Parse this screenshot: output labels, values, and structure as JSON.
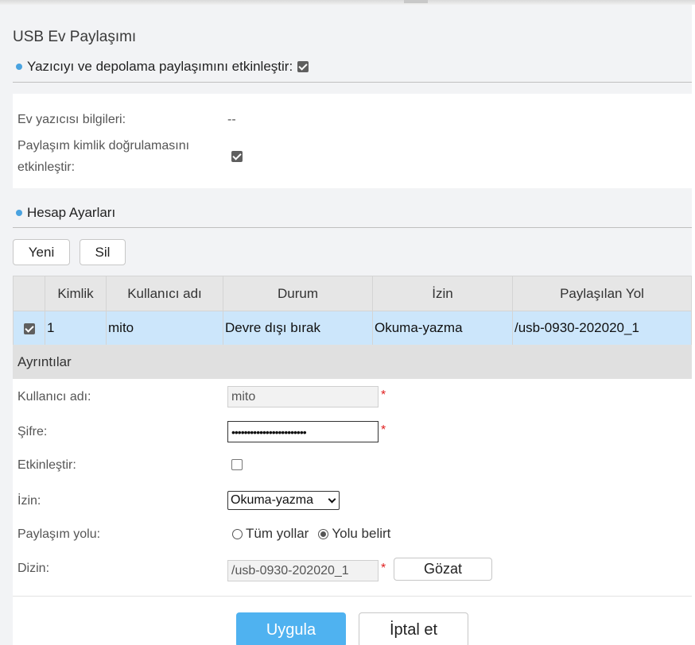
{
  "page": {
    "title": "USB Ev Paylaşımı"
  },
  "sharing": {
    "enable_label": "Yazıcıyı ve depolama paylaşımını etkinleştir:",
    "enabled": true,
    "printer_info_label": "Ev yazıcısı bilgileri:",
    "printer_info_value": "--",
    "auth_label_line1": "Paylaşım kimlik doğrulamasını",
    "auth_label_line2": "etkinleştir:",
    "auth_enabled": true
  },
  "accounts": {
    "section_title": "Hesap Ayarları",
    "new_button": "Yeni",
    "delete_button": "Sil",
    "columns": [
      "Kimlik",
      "Kullanıcı adı",
      "Durum",
      "İzin",
      "Paylaşılan Yol"
    ],
    "rows": [
      {
        "selected": true,
        "id": "1",
        "username": "mito",
        "status": "Devre dışı bırak",
        "permission": "Okuma-yazma",
        "path": "/usb-0930-202020_1"
      }
    ]
  },
  "details": {
    "title": "Ayrıntılar",
    "username_label": "Kullanıcı adı:",
    "username_value": "mito",
    "password_label": "Şifre:",
    "password_value": "••••••••••••••••••••••••",
    "enable_label": "Etkinleştir:",
    "enable_checked": false,
    "permission_label": "İzin:",
    "permission_value": "Okuma-yazma",
    "share_path_label": "Paylaşım yolu:",
    "share_path_option_all": "Tüm yollar",
    "share_path_option_specify": "Yolu belirt",
    "share_path_selected": "specify",
    "dir_label": "Dizin:",
    "dir_value": "/usb-0930-202020_1",
    "browse_button": "Gözat",
    "required_marker": "*"
  },
  "actions": {
    "apply": "Uygula",
    "cancel": "İptal et"
  },
  "colors": {
    "accent": "#4fb2f0",
    "row_selected": "#cce6fb",
    "required": "#e02020"
  }
}
